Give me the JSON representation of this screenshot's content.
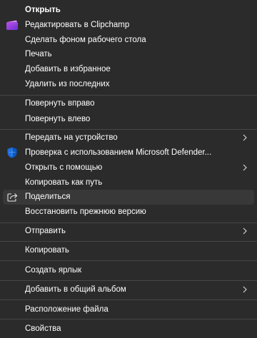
{
  "menu": {
    "items": [
      {
        "label": "Открыть"
      },
      {
        "label": "Редактировать в Clipchamp",
        "icon": "clipchamp-icon"
      },
      {
        "label": "Сделать фоном рабочего стола"
      },
      {
        "label": "Печать"
      },
      {
        "label": "Добавить в избранное"
      },
      {
        "label": "Удалить из последних"
      },
      {
        "label": "Повернуть вправо"
      },
      {
        "label": "Повернуть влево"
      },
      {
        "label": "Передать на устройство",
        "submenu": true
      },
      {
        "label": "Проверка с использованием Microsoft Defender...",
        "icon": "microsoft-defender-icon"
      },
      {
        "label": "Открыть с помощью",
        "submenu": true
      },
      {
        "label": "Копировать как путь"
      },
      {
        "label": "Поделиться",
        "icon": "share-icon",
        "state": "hovered"
      },
      {
        "label": "Восстановить прежнюю версию"
      },
      {
        "label": "Отправить",
        "submenu": true
      },
      {
        "label": "Копировать"
      },
      {
        "label": "Создать ярлык"
      },
      {
        "label": "Добавить в общий альбом",
        "submenu": true
      },
      {
        "label": "Расположение файла"
      },
      {
        "label": "Свойства"
      }
    ]
  },
  "colors": {
    "background": "#2b2b2b",
    "text": "#ffffff",
    "separator": "#474747",
    "hover": "#383838"
  }
}
